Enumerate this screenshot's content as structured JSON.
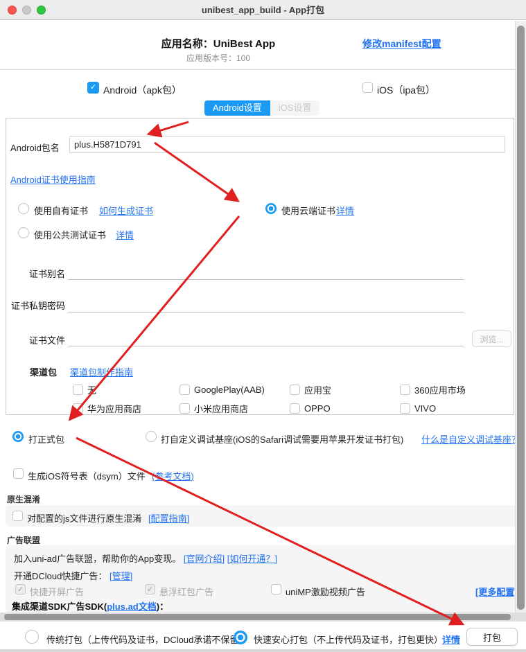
{
  "window": {
    "title": "unibest_app_build - App打包"
  },
  "header": {
    "app_name": "应用名称：UniBest App",
    "manifest_link": "修改manifest配置",
    "version": "应用版本号：100"
  },
  "platform": {
    "android_label": "Android（apk包）",
    "ios_label": "iOS（ipa包）"
  },
  "tabs": {
    "android": "Android设置",
    "ios": "iOS设置"
  },
  "android_panel": {
    "package_label": "Android包名",
    "package_value": "plus.H5871D791",
    "cert_guide_link": "Android证书使用指南",
    "cert_options": {
      "own_label": "使用自有证书",
      "own_link": "如何生成证书",
      "cloud_label": "使用云端证书",
      "cloud_link": "详情",
      "public_label": "使用公共测试证书",
      "public_link": "详情"
    },
    "fields": {
      "alias_label": "证书别名",
      "password_label": "证书私钥密码",
      "file_label": "证书文件",
      "browse_button": "浏览..."
    },
    "channel": {
      "label": "渠道包",
      "guide_link": "渠道包制作指南",
      "options": [
        "无",
        "GooglePlay(AAB)",
        "应用宝",
        "360应用市场",
        "华为应用商店",
        "小米应用商店",
        "OPPO",
        "VIVO"
      ]
    }
  },
  "build_type": {
    "release_label": "打正式包",
    "custom_base_label": "打自定义调试基座(iOS的Safari调试需要用苹果开发证书打包)",
    "custom_base_link": "什么是自定义调试基座？",
    "dsym_label": "生成iOS符号表（dsym）文件",
    "dsym_link": "(参考文档)"
  },
  "obfuscation": {
    "section_title": "原生混淆",
    "checkbox_label": "对配置的js文件进行原生混淆",
    "guide_link": "[配置指南]"
  },
  "ad": {
    "section_title": "广告联盟",
    "intro_text": "加入uni-ad广告联盟，帮助你的App变现。",
    "intro_link1": "[官网介绍]",
    "intro_link2": "[如何开通？]",
    "dcloud_text": "开通DCloud快捷广告：",
    "dcloud_link": "[管理]",
    "cb_splash": "快捷开屏广告",
    "cb_redpacket": "悬浮红包广告",
    "cb_unimp": "uniMP激励视频广告",
    "more_link": "[更多配置]",
    "sdk_prefix": "集成渠道SDK广告SDK(",
    "sdk_link": "plus.ad文档",
    "sdk_suffix": ")："
  },
  "footer": {
    "traditional_label": "传统打包（上传代码及证书，DCloud承诺不保留）",
    "fast_label": "快速安心打包（不上传代码及证书，打包更快）",
    "detail_link": "详情",
    "package_button": "打包"
  },
  "icons": {
    "check": "✓"
  },
  "colors": {
    "accent_blue": "#1b9af5",
    "link_blue": "#2373f0",
    "arrow_red": "#e02020"
  }
}
